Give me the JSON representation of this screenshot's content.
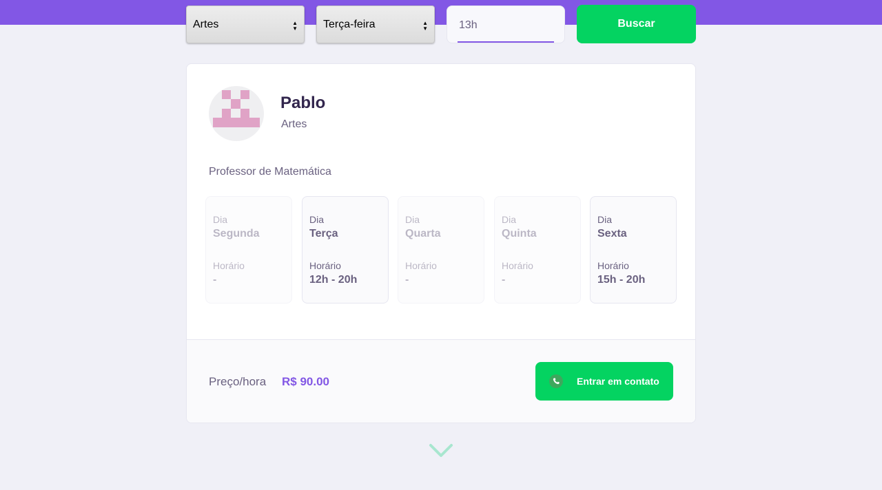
{
  "filters": {
    "subject_value": "Artes",
    "weekday_value": "Terça-feira",
    "time_value": "13h",
    "search_label": "Buscar"
  },
  "teacher": {
    "name": "Pablo",
    "subject": "Artes",
    "bio": "Professor de Matemática"
  },
  "schedule": {
    "day_label": "Dia",
    "time_label": "Horário",
    "days": [
      {
        "name": "Segunda",
        "hours": "-",
        "available": false
      },
      {
        "name": "Terça",
        "hours": "12h - 20h",
        "available": true
      },
      {
        "name": "Quarta",
        "hours": "-",
        "available": false
      },
      {
        "name": "Quinta",
        "hours": "-",
        "available": false
      },
      {
        "name": "Sexta",
        "hours": "15h - 20h",
        "available": true
      }
    ]
  },
  "footer": {
    "price_label": "Preço/hora",
    "price_value": "R$ 90.00",
    "contact_label": "Entrar em contato"
  },
  "icons": {
    "select_arrows": "up-down-arrows-icon",
    "contact": "whatsapp-icon",
    "more": "chevron-down-icon",
    "avatar": "identicon-avatar"
  },
  "colors": {
    "brand_purple": "#8257e5",
    "green": "#04d361",
    "background": "#f0f0f7",
    "title": "#32264d",
    "text": "#6a6180",
    "avatar_pink": "#e0a3c6"
  }
}
